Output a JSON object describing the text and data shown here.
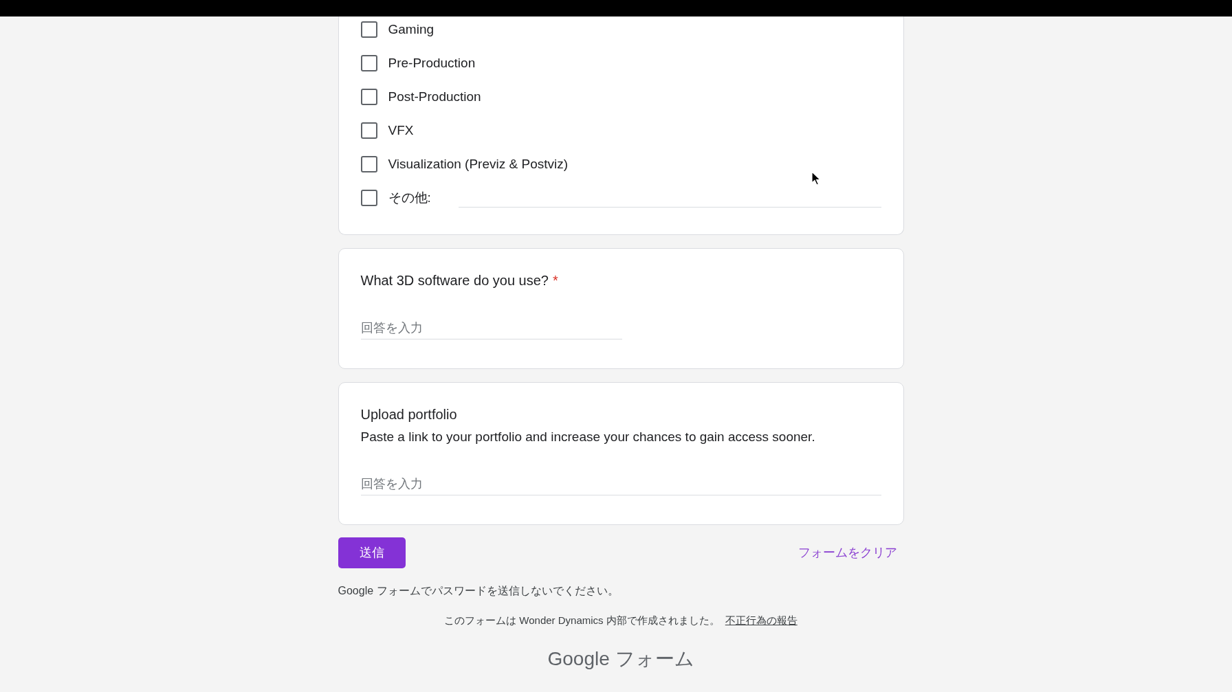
{
  "checkbox_question": {
    "options": [
      {
        "kind": "option",
        "label": "Gaming",
        "checked": false
      },
      {
        "kind": "option",
        "label": "Pre-Production",
        "checked": false
      },
      {
        "kind": "option",
        "label": "Post-Production",
        "checked": false
      },
      {
        "kind": "option",
        "label": "VFX",
        "checked": false
      },
      {
        "kind": "option",
        "label": "Visualization (Previz & Postviz)",
        "checked": false
      },
      {
        "kind": "other",
        "label": "その他:",
        "checked": false
      }
    ]
  },
  "questions": [
    {
      "kind": "short_answer",
      "title": "What 3D software do you use?",
      "required_mark": "*",
      "placeholder": "回答を入力"
    },
    {
      "kind": "paragraph",
      "title": "Upload portfolio",
      "description": "Paste a link to your portfolio and increase your chances to gain access sooner.",
      "placeholder": "回答を入力"
    }
  ],
  "submit_button": "送信",
  "clear_link": "フォームをクリア",
  "footer": {
    "password_notice": "Google フォームでパスワードを送信しないでください。",
    "creator_notice": "このフォームは Wonder Dynamics 内部で作成されました。",
    "report_link": "不正行為の報告",
    "brand": "Google フォーム"
  }
}
